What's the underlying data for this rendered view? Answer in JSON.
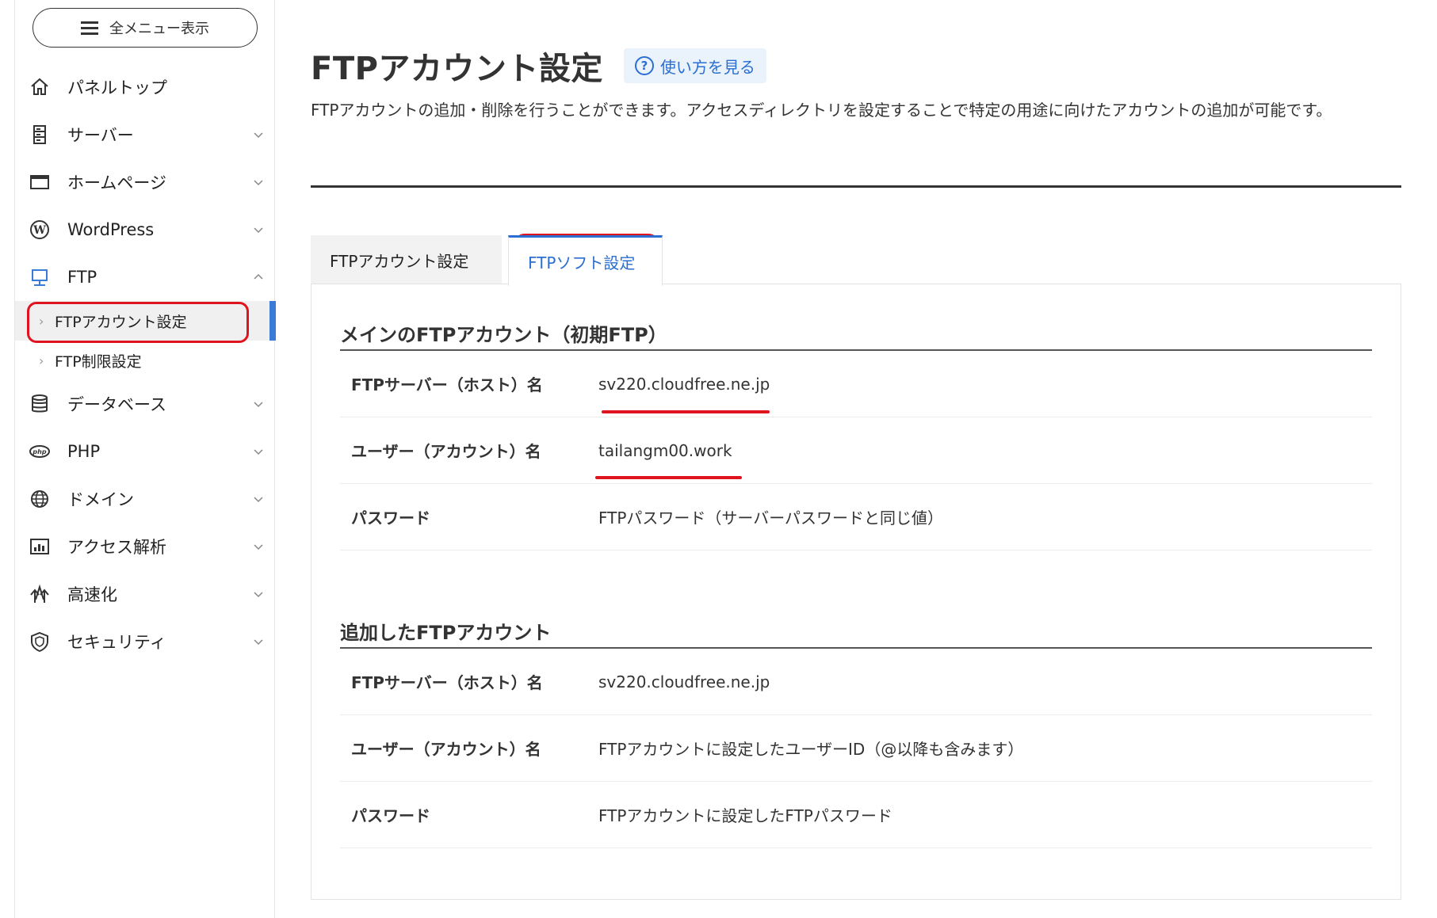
{
  "sidebar": {
    "menu_button": "全メニュー表示",
    "items": [
      {
        "label": "パネルトップ",
        "icon": "home-icon"
      },
      {
        "label": "サーバー",
        "icon": "server-icon"
      },
      {
        "label": "ホームページ",
        "icon": "browser-window-icon"
      },
      {
        "label": "WordPress",
        "icon": "wordpress-icon"
      },
      {
        "label": "FTP",
        "icon": "ftp-monitor-icon"
      }
    ],
    "sub_items": [
      {
        "label": "FTPアカウント設定"
      },
      {
        "label": "FTP制限設定"
      }
    ],
    "items2": [
      {
        "label": "データベース",
        "icon": "database-icon"
      },
      {
        "label": "PHP",
        "icon": "php-icon"
      },
      {
        "label": "ドメイン",
        "icon": "globe-icon"
      },
      {
        "label": "アクセス解析",
        "icon": "analytics-icon"
      },
      {
        "label": "高速化",
        "icon": "speed-icon"
      },
      {
        "label": "セキュリティ",
        "icon": "shield-icon"
      }
    ]
  },
  "header": {
    "title": "FTPアカウント設定",
    "help_label": "使い方を見る",
    "description": "FTPアカウントの追加・削除を行うことができます。アクセスディレクトリを設定することで特定の用途に向けたアカウントの追加が可能です。"
  },
  "tabs": [
    {
      "label": "FTPアカウント設定"
    },
    {
      "label": "FTPソフト設定"
    }
  ],
  "main_account": {
    "title": "メインのFTPアカウント（初期FTP）",
    "rows": [
      {
        "label": "FTPサーバー（ホスト）名",
        "value": "sv220.cloudfree.ne.jp"
      },
      {
        "label": "ユーザー（アカウント）名",
        "value": "tailangm00.work"
      },
      {
        "label": "パスワード",
        "value": "FTPパスワード（サーバーパスワードと同じ値）"
      }
    ]
  },
  "added_account": {
    "title": "追加したFTPアカウント",
    "rows": [
      {
        "label": "FTPサーバー（ホスト）名",
        "value": "sv220.cloudfree.ne.jp"
      },
      {
        "label": "ユーザー（アカウント）名",
        "value": "FTPアカウントに設定したユーザーID（@以降も含みます）"
      },
      {
        "label": "パスワード",
        "value": "FTPアカウントに設定したFTPパスワード"
      }
    ]
  },
  "colors": {
    "accent": "#2a6fd1",
    "annotation_red": "#e0141e",
    "active_bar": "#3a7bd5"
  }
}
